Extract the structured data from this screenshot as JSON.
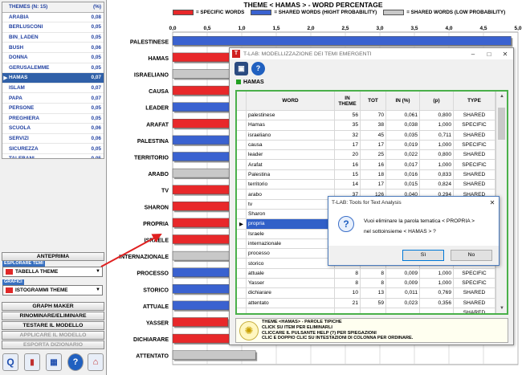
{
  "themes_panel": {
    "header_name": "THEMES (N: 15)",
    "header_value": "(%)",
    "selected_index": 7,
    "items": [
      {
        "name": "ARABIA",
        "value": "0,08"
      },
      {
        "name": "BERLUSCONI",
        "value": "0,05"
      },
      {
        "name": "BIN_LADEN",
        "value": "0,05"
      },
      {
        "name": "BUSH",
        "value": "0,06"
      },
      {
        "name": "DONNA",
        "value": "0,05"
      },
      {
        "name": "GERUSALEMME",
        "value": "0,05"
      },
      {
        "name": "HAMAS",
        "value": "0,07"
      },
      {
        "name": "ISLAM",
        "value": "0,07"
      },
      {
        "name": "PAPA",
        "value": "0,07"
      },
      {
        "name": "PERSONE",
        "value": "0,05"
      },
      {
        "name": "PREGHIERA",
        "value": "0,05"
      },
      {
        "name": "SCUOLA",
        "value": "0,06"
      },
      {
        "name": "SERVIZI",
        "value": "0,06"
      },
      {
        "name": "SICUREZZA",
        "value": "0,05"
      },
      {
        "name": "TALEBANI",
        "value": "0,05"
      }
    ]
  },
  "left_controls": {
    "anteprima": "ANTEPRIMA",
    "esplorare_label": "ESPLORARE TEMI",
    "esplorare_value": "TABELLA THEME",
    "grafici_label": "GRAFICI",
    "grafici_value": "ISTOGRAMMI THEME",
    "graph_maker": "GRAPH MAKER",
    "rinominare": "RINOMINARE/ELIMINARE",
    "testare": "TESTARE IL MODELLO",
    "applicare": "APPLICARE IL MODELLO",
    "esporta": "ESPORTA DIZIONARIO"
  },
  "chart_data": {
    "type": "bar",
    "orientation": "horizontal",
    "title": "THEME < HAMAS > - WORD PERCENTAGE",
    "legend": [
      {
        "name": "= SPECIFIC WORDS",
        "color": "#e8282a"
      },
      {
        "name": "= SHARED WORDS (HIGHT PROBABILITY)",
        "color": "#3a62d0"
      },
      {
        "name": "= SHARED WORDS (LOW PROBABILITY)",
        "color": "#c8c8c8"
      }
    ],
    "xlim": [
      0,
      5
    ],
    "xticks": [
      "0,0",
      "0,5",
      "1,0",
      "1,5",
      "2,0",
      "2,5",
      "3,0",
      "3,5",
      "4,0",
      "4,5",
      "5,0"
    ],
    "categories": [
      "PALESTINESE",
      "HAMAS",
      "ISRAELIANO",
      "CAUSA",
      "LEADER",
      "ARAFAT",
      "PALESTINA",
      "TERRITORIO",
      "ARABO",
      "TV",
      "SHARON",
      "PROPRIA",
      "ISRAELE",
      "INTERNAZIONALE",
      "PROCESSO",
      "STORICO",
      "ATTUALE",
      "YASSER",
      "DICHIARARE",
      "ATTENTATO"
    ],
    "values": [
      4.9,
      4.5,
      4.3,
      4.0,
      3.5,
      3.2,
      3.0,
      2.9,
      2.8,
      2.7,
      2.6,
      2.5,
      2.4,
      2.3,
      2.2,
      1.1,
      0.9,
      0.8,
      1.0,
      1.2
    ],
    "types": [
      "shared_high",
      "specific",
      "shared_low",
      "specific",
      "shared_high",
      "specific",
      "shared_high",
      "shared_high",
      "shared_low",
      "specific",
      "specific",
      "specific",
      "specific",
      "shared_low",
      "shared_high",
      "shared_high",
      "shared_high",
      "specific",
      "specific",
      "shared_low"
    ],
    "grid": true
  },
  "dialog": {
    "title": "T-LAB: MODELLIZZAZIONE DEI TEMI EMERGENTI",
    "theme_name": "HAMAS",
    "columns": [
      "WORD",
      "IN THEME",
      "TOT",
      "IN (%)",
      "(p)",
      "TYPE"
    ],
    "rows": [
      [
        "palestinese",
        "56",
        "70",
        "0,061",
        "0,800",
        "SHARED"
      ],
      [
        "Hamas",
        "35",
        "38",
        "0,038",
        "1,000",
        "SPECIFIC"
      ],
      [
        "israeliano",
        "32",
        "45",
        "0,035",
        "0,711",
        "SHARED"
      ],
      [
        "causa",
        "17",
        "17",
        "0,019",
        "1,000",
        "SPECIFIC"
      ],
      [
        "leader",
        "20",
        "25",
        "0,022",
        "0,800",
        "SHARED"
      ],
      [
        "Arafat",
        "16",
        "16",
        "0,017",
        "1,000",
        "SPECIFIC"
      ],
      [
        "Palestina",
        "15",
        "18",
        "0,016",
        "0,833",
        "SHARED"
      ],
      [
        "territorio",
        "14",
        "17",
        "0,015",
        "0,824",
        "SHARED"
      ],
      [
        "arabo",
        "37",
        "126",
        "0,040",
        "0,294",
        "SHARED"
      ],
      [
        "tv",
        "",
        "",
        "",
        "",
        ""
      ],
      [
        "Sharon",
        "",
        "",
        "",
        "",
        ""
      ],
      [
        "propria",
        "",
        "",
        "",
        "",
        "CIFIC"
      ],
      [
        "Israele",
        "",
        "",
        "",
        "",
        "ED"
      ],
      [
        "internazionale",
        "",
        "",
        "",
        "",
        "ED"
      ],
      [
        "processo",
        "",
        "",
        "",
        "",
        "ED"
      ],
      [
        "storico",
        "",
        "",
        "",
        "",
        "ED"
      ],
      [
        "attuale",
        "8",
        "8",
        "0,009",
        "1,000",
        "SPECIFIC"
      ],
      [
        "Yasser",
        "8",
        "8",
        "0,009",
        "1,000",
        "SPECIFIC"
      ],
      [
        "dichiarare",
        "10",
        "13",
        "0,011",
        "0,769",
        "SHARED"
      ],
      [
        "attentato",
        "21",
        "59",
        "0,023",
        "0,356",
        "SHARED"
      ],
      [
        "",
        "",
        "",
        "",
        "",
        "SHARED"
      ]
    ],
    "selected_row": 11,
    "help_lines": [
      "THEME <HAMAS> - PAROLE TIPICHE",
      "CLICK SU ITEM PER ELIMINARLI",
      "CLICCARE IL PULSANTE HELP (?) PER SPIEGAZIONI",
      "CLIC E DOPPIO CLIC SU INTESTAZIONI DI COLONNA PER ORDINARE."
    ]
  },
  "msgbox": {
    "title": "T-LAB: Tools for Text Analysis",
    "line1": "Vuoi eliminare la parola tematica < PROPRIA >",
    "line2": "nel sottoinsieme  < HAMAS > ?",
    "yes": "Sì",
    "no": "No"
  }
}
